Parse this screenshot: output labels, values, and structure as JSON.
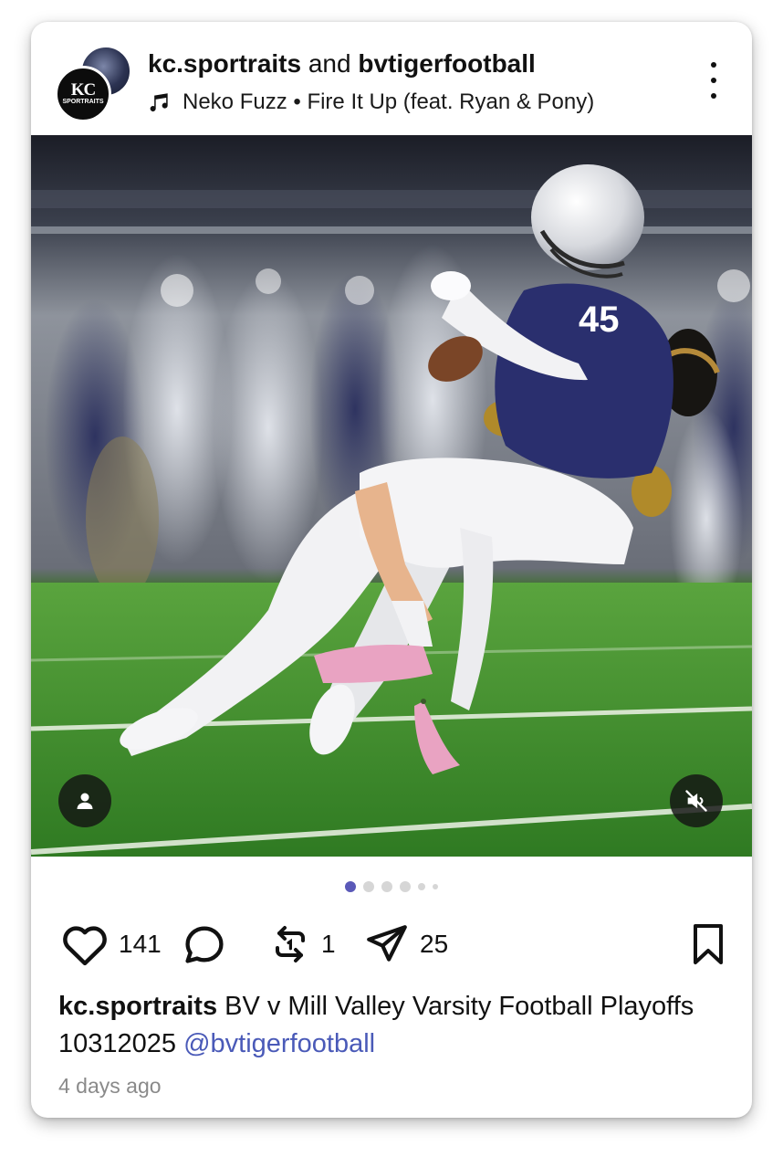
{
  "header": {
    "author_primary": "kc.sportraits",
    "author_joiner": " and ",
    "author_secondary": "bvtigerfootball",
    "avatar_text_top": "KC",
    "avatar_text_bottom": "SPORTRAITS",
    "music_icon": "music-note-icon",
    "music_title": "Neko Fuzz • Fire It Up (feat. Ryan & Pony)",
    "more_icon": "more-vertical-icon"
  },
  "media": {
    "jersey_number": "45",
    "tag_icon": "person-icon",
    "mute_icon": "muted-speaker-icon",
    "carousel_pages": 6,
    "carousel_active_index": 0
  },
  "actions": {
    "like_icon": "heart-icon",
    "like_count": "141",
    "comment_icon": "comment-icon",
    "repost_icon": "repost-icon",
    "repost_count": "1",
    "share_icon": "send-icon",
    "share_count": "25",
    "bookmark_icon": "bookmark-icon"
  },
  "caption": {
    "user": "kc.sportraits",
    "text": " BV v Mill Valley Varsity Football Playoffs 10312025 ",
    "mention": "@bvtigerfootball"
  },
  "timestamp": "4 days ago",
  "colors": {
    "accent": "#5a59b8",
    "mention": "#4a5ab8",
    "jersey_navy": "#2a2f6e",
    "field_green": "#3f8f2a",
    "shoe_pink": "#e6a6c4"
  }
}
